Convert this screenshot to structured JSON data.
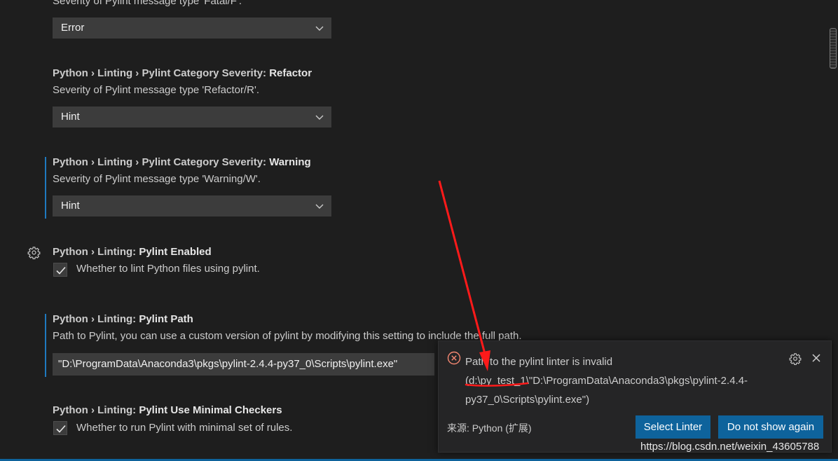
{
  "settings": {
    "fatal": {
      "desc": "Severity of Pylint message type 'Fatal/F'.",
      "value": "Error"
    },
    "refactor": {
      "prefix": "Python › Linting › Pylint Category Severity: ",
      "name": "Refactor",
      "desc": "Severity of Pylint message type 'Refactor/R'.",
      "value": "Hint"
    },
    "warning": {
      "prefix": "Python › Linting › Pylint Category Severity: ",
      "name": "Warning",
      "desc": "Severity of Pylint message type 'Warning/W'.",
      "value": "Hint"
    },
    "enabled": {
      "prefix": "Python › Linting: ",
      "name": "Pylint Enabled",
      "desc": "Whether to lint Python files using pylint.",
      "checked": true
    },
    "path": {
      "prefix": "Python › Linting: ",
      "name": "Pylint Path",
      "desc": "Path to Pylint, you can use a custom version of pylint by modifying this setting to include the full path.",
      "value": "\"D:\\ProgramData\\Anaconda3\\pkgs\\pylint-2.4.4-py37_0\\Scripts\\pylint.exe\""
    },
    "minimal": {
      "prefix": "Python › Linting: ",
      "name": "Pylint Use Minimal Checkers",
      "desc": "Whether to run Pylint with minimal set of rules.",
      "checked": true
    }
  },
  "notification": {
    "line1": "Path to the pylint linter is invalid",
    "line2": "(d:\\py_test_1\\\"D:\\ProgramData\\Anaconda3\\pkgs\\pylint-2.4.4-",
    "line3": "py37_0\\Scripts\\pylint.exe\")",
    "source": "来源: Python (扩展)",
    "select_label": "Select Linter",
    "dont_show_label": "Do not show again"
  },
  "watermark": "https://blog.csdn.net/weixin_43605788",
  "colors": {
    "background": "#1e1e1e",
    "accent": "#0e639c",
    "modified_bar": "#1f79bf",
    "error": "#f48771",
    "annotation": "#ff1a1a"
  },
  "icons": [
    "gear-icon",
    "chevron-down-icon",
    "check-icon",
    "error-icon",
    "close-icon"
  ]
}
